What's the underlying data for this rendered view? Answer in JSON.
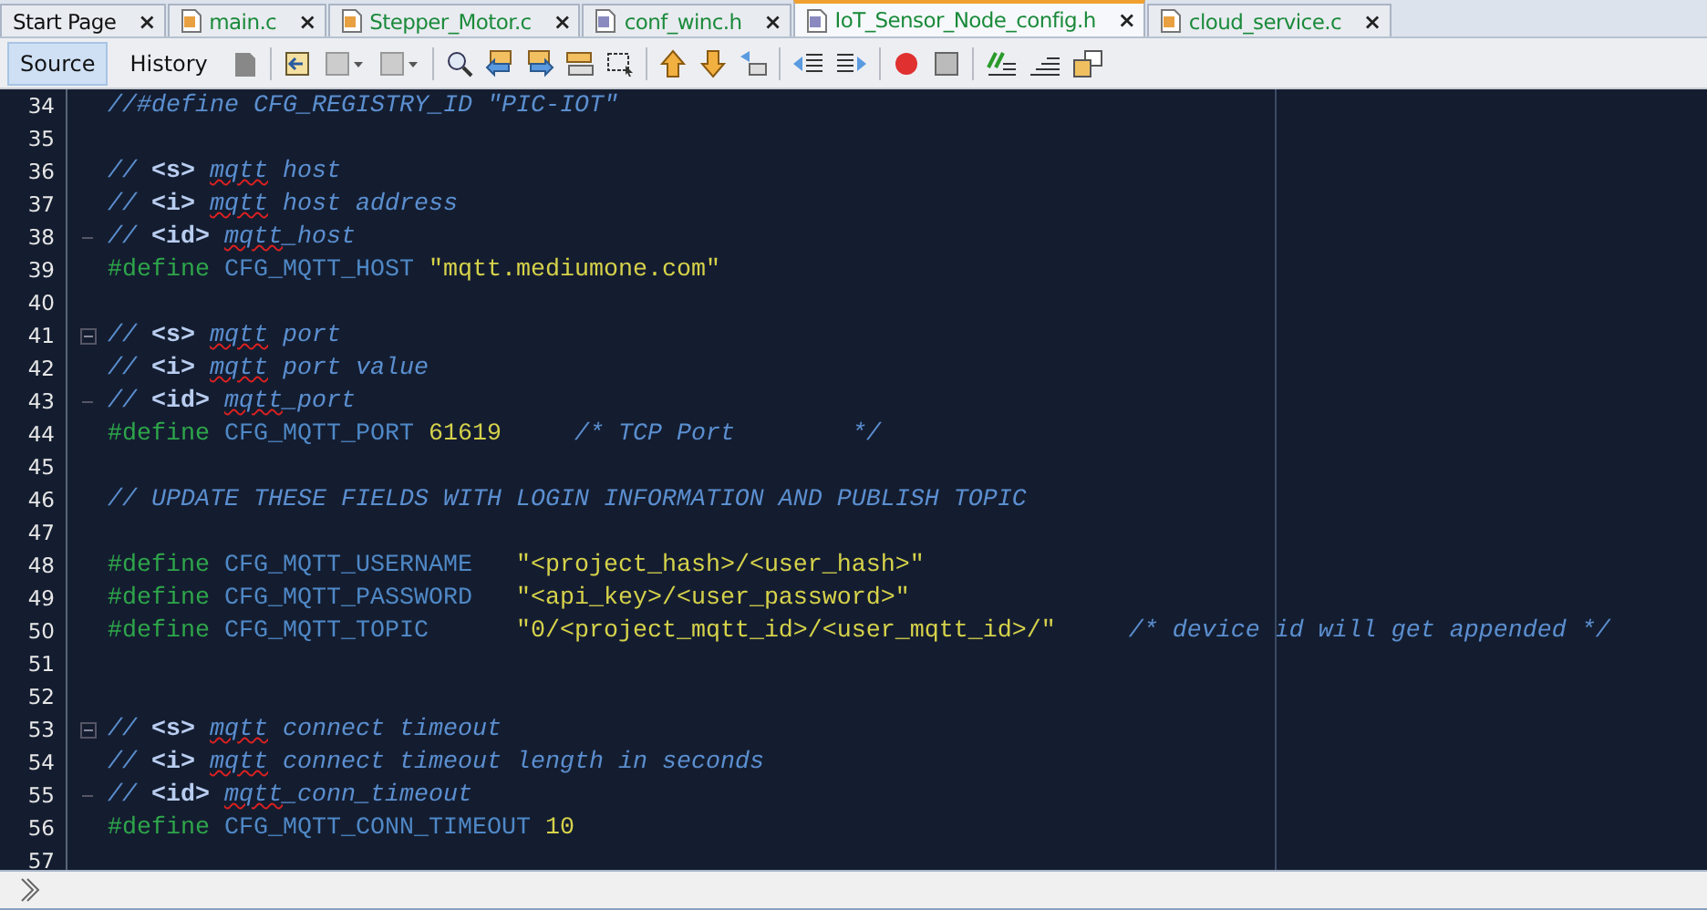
{
  "tabs": [
    {
      "label": "Start Page",
      "kind": "page",
      "selected": false,
      "close": "×"
    },
    {
      "label": "main.c",
      "kind": "c",
      "selected": false,
      "close": "×"
    },
    {
      "label": "Stepper_Motor.c",
      "kind": "c",
      "selected": false,
      "close": "×"
    },
    {
      "label": "conf_winc.h",
      "kind": "h",
      "selected": false,
      "close": "×"
    },
    {
      "label": "IoT_Sensor_Node_config.h",
      "kind": "h",
      "selected": true,
      "close": "×"
    },
    {
      "label": "cloud_service.c",
      "kind": "c",
      "selected": false,
      "close": "×"
    }
  ],
  "view_buttons": [
    {
      "label": "Source",
      "selected": true
    },
    {
      "label": "History",
      "selected": false
    }
  ],
  "editor": {
    "lines": [
      {
        "number": "34",
        "kind": "plain",
        "segments": [
          {
            "kind": "comment",
            "text": "//#define CFG_REGISTRY_ID \"PIC-IOT\""
          }
        ]
      },
      {
        "number": "35",
        "kind": "plain"
      },
      {
        "number": "36",
        "kind": "plain",
        "segments": [
          {
            "kind": "comment",
            "text": "// "
          },
          {
            "kind": "tag",
            "text": "<s> "
          },
          {
            "kind": "spell",
            "text": "mqtt"
          },
          {
            "kind": "comment",
            "text": " host"
          }
        ]
      },
      {
        "number": "37",
        "kind": "plain",
        "segments": [
          {
            "kind": "comment",
            "text": "// "
          },
          {
            "kind": "tag",
            "text": "<i> "
          },
          {
            "kind": "spell",
            "text": "mqtt"
          },
          {
            "kind": "comment",
            "text": " host address"
          }
        ]
      },
      {
        "number": "38",
        "kind": "fold_end",
        "segments": [
          {
            "kind": "comment",
            "text": "// "
          },
          {
            "kind": "tag",
            "text": "<id> "
          },
          {
            "kind": "spell",
            "text": "mqtt"
          },
          {
            "kind": "comment",
            "text": "_host"
          }
        ]
      },
      {
        "number": "39",
        "kind": "plain",
        "segments": [
          {
            "kind": "define",
            "text": "#define"
          },
          {
            "kind": "ident",
            "text": " CFG_MQTT_HOST "
          },
          {
            "kind": "string",
            "text": "\"mqtt.mediumone.com\""
          }
        ]
      },
      {
        "number": "40",
        "kind": "plain"
      },
      {
        "number": "41",
        "kind": "fold_start",
        "segments": [
          {
            "kind": "comment",
            "text": "// "
          },
          {
            "kind": "tag",
            "text": "<s> "
          },
          {
            "kind": "spell",
            "text": "mqtt"
          },
          {
            "kind": "comment",
            "text": " port"
          }
        ]
      },
      {
        "number": "42",
        "kind": "plain",
        "segments": [
          {
            "kind": "comment",
            "text": "// "
          },
          {
            "kind": "tag",
            "text": "<i> "
          },
          {
            "kind": "spell",
            "text": "mqtt"
          },
          {
            "kind": "comment",
            "text": " port value"
          }
        ]
      },
      {
        "number": "43",
        "kind": "fold_end",
        "segments": [
          {
            "kind": "comment",
            "text": "// "
          },
          {
            "kind": "tag",
            "text": "<id> "
          },
          {
            "kind": "spell",
            "text": "mqtt"
          },
          {
            "kind": "comment",
            "text": "_port"
          }
        ]
      },
      {
        "number": "44",
        "kind": "plain",
        "segments": [
          {
            "kind": "define",
            "text": "#define"
          },
          {
            "kind": "ident",
            "text": " CFG_MQTT_PORT "
          },
          {
            "kind": "number",
            "text": "61619"
          },
          {
            "kind": "comment",
            "text": "     /* TCP Port        */"
          }
        ]
      },
      {
        "number": "45",
        "kind": "plain"
      },
      {
        "number": "46",
        "kind": "plain",
        "segments": [
          {
            "kind": "comment",
            "text": "// UPDATE THESE FIELDS WITH LOGIN INFORMATION AND PUBLISH TOPIC"
          }
        ]
      },
      {
        "number": "47",
        "kind": "plain"
      },
      {
        "number": "48",
        "kind": "plain",
        "segments": [
          {
            "kind": "define",
            "text": "#define"
          },
          {
            "kind": "ident",
            "text": " CFG_MQTT_USERNAME   "
          },
          {
            "kind": "string",
            "text": "\"<project_hash>/<user_hash>\""
          }
        ]
      },
      {
        "number": "49",
        "kind": "plain",
        "segments": [
          {
            "kind": "define",
            "text": "#define"
          },
          {
            "kind": "ident",
            "text": " CFG_MQTT_PASSWORD   "
          },
          {
            "kind": "string",
            "text": "\"<api_key>/<user_password>\""
          }
        ]
      },
      {
        "number": "50",
        "kind": "plain",
        "segments": [
          {
            "kind": "define",
            "text": "#define"
          },
          {
            "kind": "ident",
            "text": " CFG_MQTT_TOPIC      "
          },
          {
            "kind": "string",
            "text": "\"0/<project_mqtt_id>/<user_mqtt_id>/\""
          },
          {
            "kind": "comment",
            "text": "     /* device id will get appended */"
          }
        ]
      },
      {
        "number": "51",
        "kind": "plain"
      },
      {
        "number": "52",
        "kind": "plain"
      },
      {
        "number": "53",
        "kind": "fold_start",
        "segments": [
          {
            "kind": "comment",
            "text": "// "
          },
          {
            "kind": "tag",
            "text": "<s> "
          },
          {
            "kind": "spell",
            "text": "mqtt"
          },
          {
            "kind": "comment",
            "text": " connect timeout"
          }
        ]
      },
      {
        "number": "54",
        "kind": "plain",
        "segments": [
          {
            "kind": "comment",
            "text": "// "
          },
          {
            "kind": "tag",
            "text": "<i> "
          },
          {
            "kind": "spell",
            "text": "mqtt"
          },
          {
            "kind": "comment",
            "text": " connect timeout length in seconds"
          }
        ]
      },
      {
        "number": "55",
        "kind": "fold_end",
        "segments": [
          {
            "kind": "comment",
            "text": "// "
          },
          {
            "kind": "tag",
            "text": "<id> "
          },
          {
            "kind": "spell",
            "text": "mqtt"
          },
          {
            "kind": "comment",
            "text": "_conn_timeout"
          }
        ]
      },
      {
        "number": "56",
        "kind": "plain",
        "segments": [
          {
            "kind": "define",
            "text": "#define"
          },
          {
            "kind": "ident",
            "text": " CFG_MQTT_CONN_TIMEOUT "
          },
          {
            "kind": "number",
            "text": "10"
          }
        ]
      },
      {
        "number": "57",
        "kind": "plain"
      }
    ]
  }
}
